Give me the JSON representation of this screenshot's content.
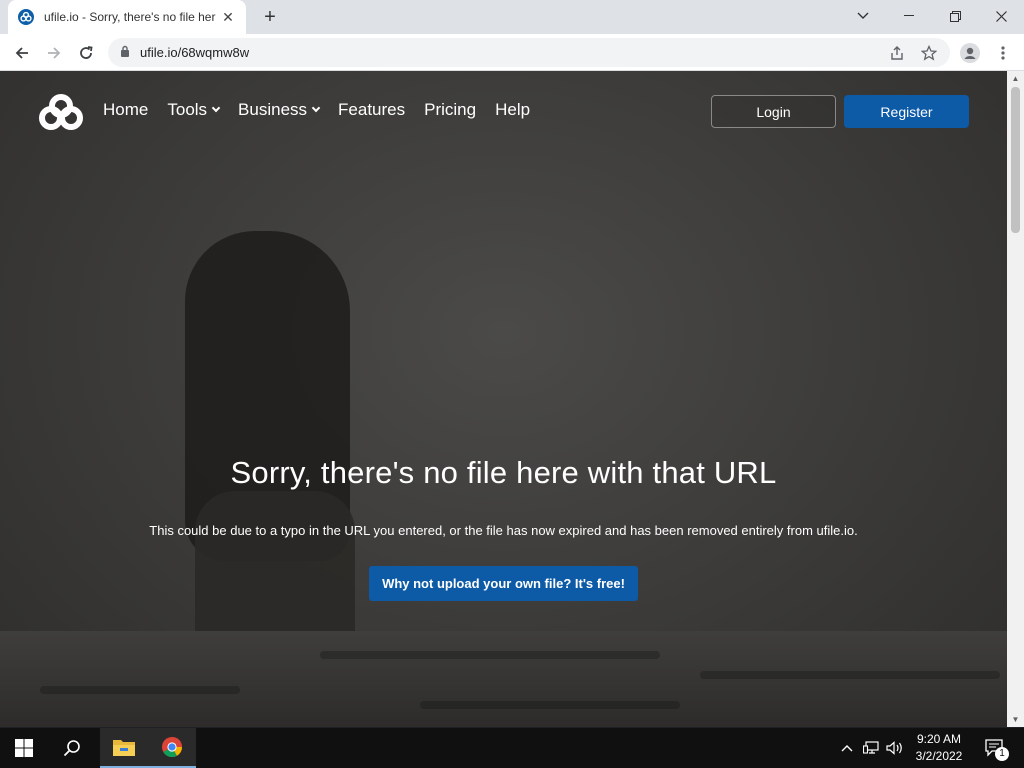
{
  "browser": {
    "tab_title": "ufile.io - Sorry, there's no file her",
    "url": "ufile.io/68wqmw8w"
  },
  "site": {
    "nav": [
      {
        "label": "Home",
        "has_dropdown": false
      },
      {
        "label": "Tools",
        "has_dropdown": true
      },
      {
        "label": "Business",
        "has_dropdown": true
      },
      {
        "label": "Features",
        "has_dropdown": false
      },
      {
        "label": "Pricing",
        "has_dropdown": false
      },
      {
        "label": "Help",
        "has_dropdown": false
      }
    ],
    "login_label": "Login",
    "register_label": "Register",
    "headline": "Sorry, there's no file here with that URL",
    "subtext": "This could be due to a typo in the URL you entered, or the file has now expired and has been removed entirely from ufile.io.",
    "cta_label": "Why not upload your own file? It's free!",
    "brand_color": "#0d5aa7"
  },
  "taskbar": {
    "time": "9:20 AM",
    "date": "3/2/2022",
    "notification_count": "1"
  }
}
